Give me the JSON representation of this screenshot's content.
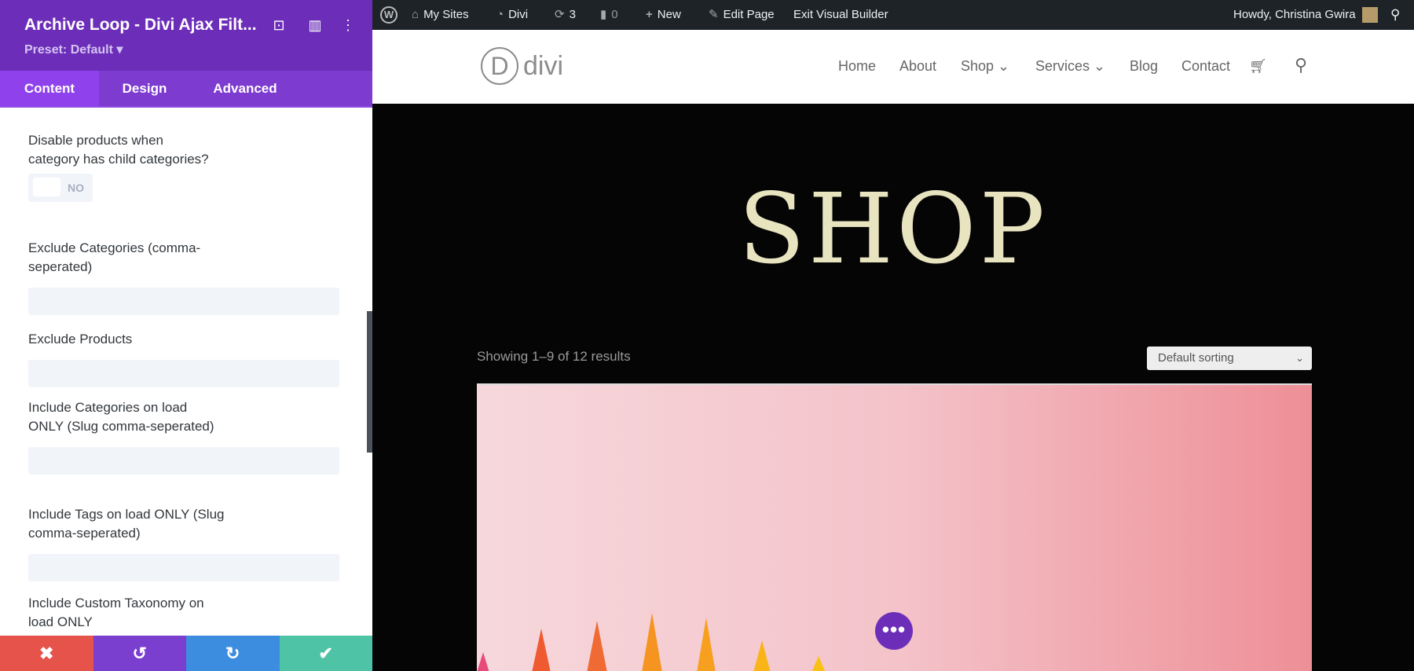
{
  "sidebar": {
    "title": "Archive Loop - Divi Ajax Filt...",
    "preset": "Preset: Default ▾",
    "header_icons": [
      "focus-icon",
      "layout-icon",
      "more-vertical-icon"
    ],
    "tabs": [
      {
        "label": "Content",
        "active": true
      },
      {
        "label": "Design"
      },
      {
        "label": "Advanced"
      }
    ],
    "fields": [
      {
        "label": "Disable products when category has child categories?",
        "toggle": "NO"
      },
      {
        "label": "Exclude Categories (comma-seperated)",
        "value": ""
      },
      {
        "label": "Exclude Products",
        "value": ""
      },
      {
        "label": "Include Categories on load ONLY (Slug comma-seperated)",
        "value": ""
      },
      {
        "label": "Include Tags on load ONLY (Slug comma-seperated)",
        "value": ""
      },
      {
        "label": "Include Custom Taxonomy on load ONLY"
      }
    ],
    "footer": {
      "cancel": "✖",
      "undo": "↺",
      "redo": "↻",
      "save": "✔",
      "colors": {
        "cancel": "#e5534b",
        "undo": "#7b3fd0",
        "redo": "#3c8ddf",
        "save": "#4fc3a6"
      }
    }
  },
  "adminbar": {
    "wp_icon": "W",
    "my_sites": "My Sites",
    "site": "Divi",
    "updates": "3",
    "comments": "0",
    "new": "New",
    "edit_page": "Edit Page",
    "exit_builder": "Exit Visual Builder",
    "howdy": "Howdy, Christina Gwira"
  },
  "header": {
    "logo_letter": "D",
    "logo_text": "divi",
    "nav": [
      "Home",
      "About",
      "Shop ⌄",
      "Services ⌄",
      "Blog",
      "Contact"
    ]
  },
  "hero": {
    "title": "SHOP",
    "results": "Showing 1–9 of 12 results",
    "sort": "Default sorting"
  },
  "fab": "•••"
}
